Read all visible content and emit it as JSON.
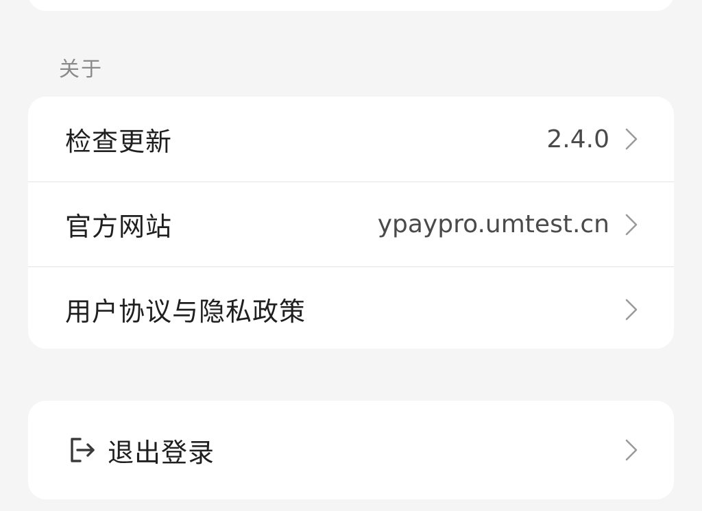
{
  "about_section": {
    "title": "关于",
    "items": [
      {
        "label": "检查更新",
        "value": "2.4.0"
      },
      {
        "label": "官方网站",
        "value": "ypaypro.umtest.cn"
      },
      {
        "label": "用户协议与隐私政策",
        "value": ""
      }
    ]
  },
  "logout": {
    "label": "退出登录",
    "icon": "logout-icon"
  },
  "icons": {
    "chevron": "chevron-right-icon"
  },
  "colors": {
    "background": "#f5f5f5",
    "card": "#ffffff",
    "text_primary": "#1f1f1f",
    "text_secondary": "#8a8a8a",
    "chevron": "#9a9a9a"
  }
}
